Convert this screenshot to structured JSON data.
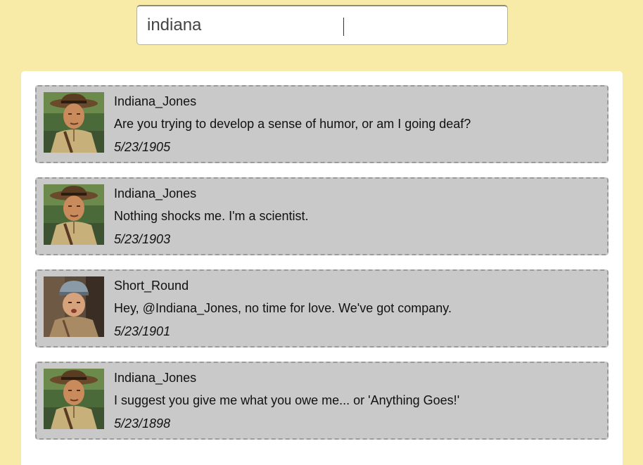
{
  "search": {
    "value": "indiana",
    "placeholder": ""
  },
  "tweets": [
    {
      "username": "Indiana_Jones",
      "text": "Are you trying to develop a sense of humor, or am I going deaf?",
      "date": "5/23/1905",
      "avatar": "indiana-jones-avatar"
    },
    {
      "username": "Indiana_Jones",
      "text": "Nothing shocks me. I'm a scientist.",
      "date": "5/23/1903",
      "avatar": "indiana-jones-avatar"
    },
    {
      "username": "Short_Round",
      "text": "Hey, @Indiana_Jones, no time for love. We've got company.",
      "date": "5/23/1901",
      "avatar": "short-round-avatar"
    },
    {
      "username": "Indiana_Jones",
      "text": "I suggest you give me what you owe me... or 'Anything Goes!'",
      "date": "5/23/1898",
      "avatar": "indiana-jones-avatar"
    }
  ],
  "colors": {
    "page_background": "#f8eaa7",
    "panel_background": "#ffffff",
    "tweet_background": "#c9c9c9",
    "tweet_border": "#9a9a9a"
  }
}
